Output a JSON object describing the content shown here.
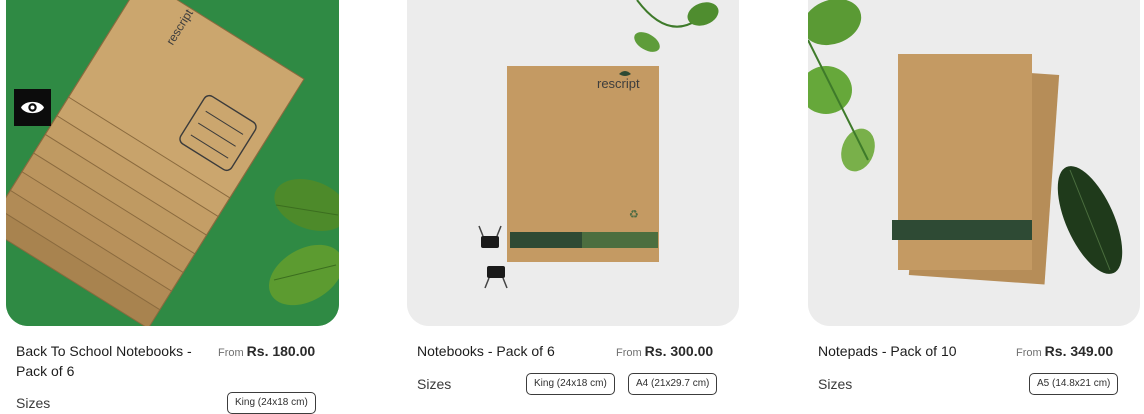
{
  "products": [
    {
      "title": "Back To School Notebooks - Pack of 6",
      "price_prefix": "From",
      "price": "Rs. 180.00",
      "sizes_label": "Sizes",
      "sizes": [
        "King (24x18 cm)"
      ],
      "image_brand_text": "rescript",
      "quick_view_icon": "eye-icon"
    },
    {
      "title": "Notebooks - Pack of 6",
      "price_prefix": "From",
      "price": "Rs. 300.00",
      "sizes_label": "Sizes",
      "sizes": [
        "King (24x18 cm)",
        "A4 (21x29.7 cm)"
      ],
      "image_brand_text": "rescript"
    },
    {
      "title": "Notepads - Pack of 10",
      "price_prefix": "From",
      "price": "Rs. 349.00",
      "sizes_label": "Sizes",
      "sizes": [
        "A5 (14.8x21 cm)"
      ]
    }
  ],
  "colors": {
    "green_background": "#2f8a44",
    "kraft": "#c49a63",
    "band_dark_green": "#2e4a34"
  }
}
